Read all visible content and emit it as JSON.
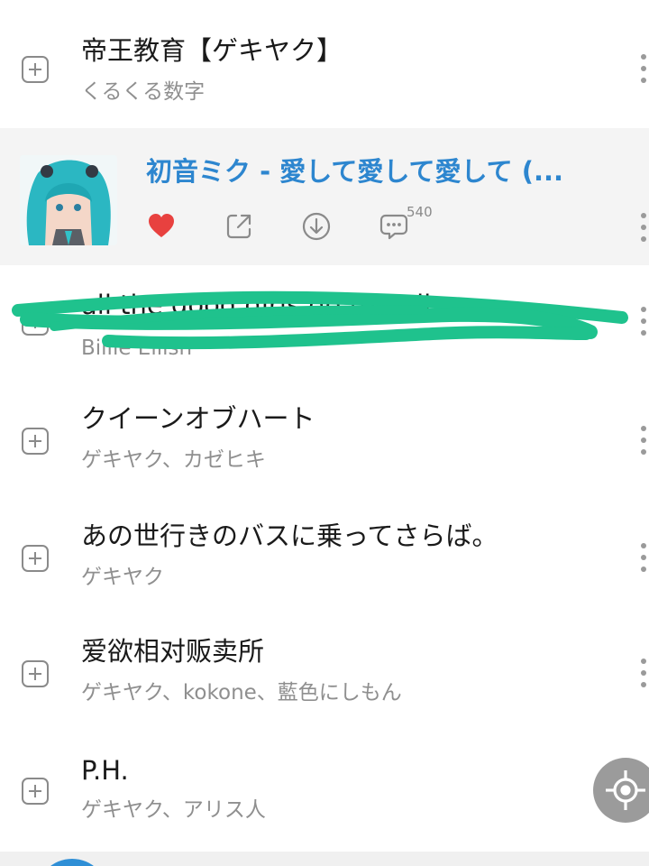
{
  "songs": [
    {
      "title": "帝王教育【ゲキヤク】",
      "artist": "くるくる数字"
    },
    {
      "title": "all the good girls go to hell",
      "artist": "Billie Eilish"
    },
    {
      "title": "クイーンオブハート",
      "artist": "ゲキヤク、カゼヒキ"
    },
    {
      "title": "あの世行きのバスに乗ってさらば。",
      "artist": "ゲキヤク"
    },
    {
      "title": "爱欲相对贩卖所",
      "artist": "ゲキヤク、kokone、藍色にしもん"
    },
    {
      "title": "P.H.",
      "artist": "ゲキヤク、アリス人"
    }
  ],
  "now_playing": {
    "title": "初音ミク - 愛して愛して愛して (...",
    "comment_count": "540"
  },
  "icons": {
    "add": "add-to-playlist-icon",
    "more": "more-vertical-icon",
    "like": "heart-icon",
    "share": "share-icon",
    "download": "download-icon",
    "comment": "comment-icon",
    "locate": "locate-current-icon"
  },
  "colors": {
    "accent": "#2d86cf",
    "like": "#e8413f",
    "scribble": "#1fc28d"
  }
}
